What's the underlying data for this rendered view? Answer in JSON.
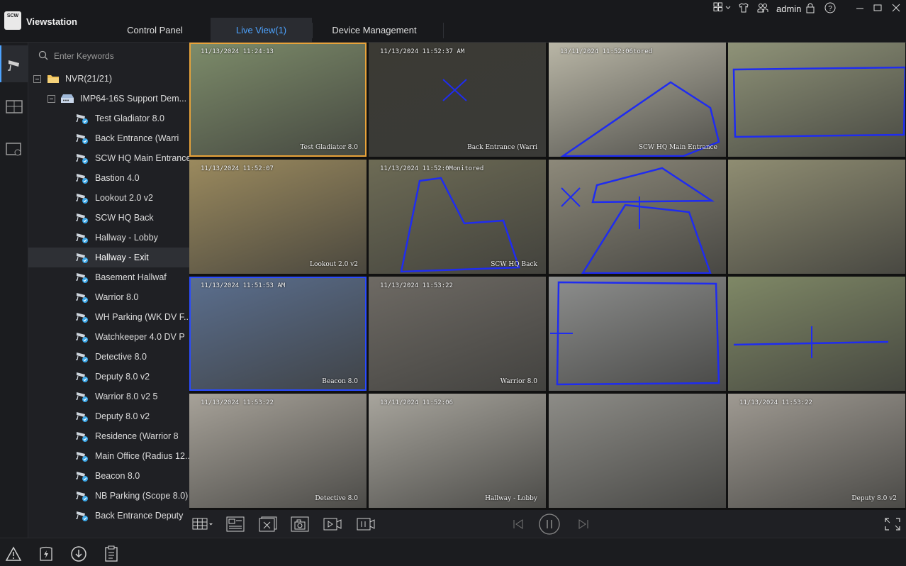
{
  "app": {
    "title": "Viewstation",
    "logo_text": "SCW"
  },
  "tabs": [
    {
      "label": "Control Panel"
    },
    {
      "label": "Live View(1)"
    },
    {
      "label": "Device Management"
    }
  ],
  "user": {
    "name": "admin"
  },
  "icons": {
    "layout": "grid-icon",
    "theme": "shirt-icon",
    "users": "users-icon",
    "lock": "lock-icon",
    "help": "help-icon"
  },
  "search": {
    "placeholder": "Enter Keywords",
    "value": ""
  },
  "tree": {
    "root": "NVR(21/21)",
    "device": "IMP64-16S Support Dem...",
    "cameras": [
      "Test Gladiator 8.0",
      "Back Entrance (Warri",
      "SCW HQ Main Entrance",
      "Bastion 4.0",
      "Lookout 2.0 v2",
      "SCW HQ Back",
      "Hallway - Lobby",
      "Hallway - Exit",
      "Basement Hallwaf",
      "Warrior 8.0",
      "WH Parking (WK DV F...",
      "Watchkeeper 4.0 DV P",
      "Detective 8.0",
      "Deputy 8.0 v2",
      "Warrior 8.0 v2 5",
      "Deputy 8.0 v2",
      "Residence (Warrior 8",
      "Main Office (Radius 12...",
      "Beacon 8.0",
      "NB Parking (Scope 8.0)",
      "Back Entrance Deputy"
    ],
    "selected_index": 7
  },
  "tiles": [
    {
      "ts": "11/13/2024 11:24:13",
      "name": "Test Gladiator 8.0",
      "bg": "#7d8c6a"
    },
    {
      "ts": "11/13/2024 11:52:37 AM",
      "name": "Back Entrance (Warri",
      "bg": "#3b3a34"
    },
    {
      "ts": "13/11/2024 11:52:06tored",
      "name": "SCW HQ Main Entrance",
      "bg": "#b9b6a6"
    },
    {
      "ts": "",
      "name": "",
      "bg": "#8f9378"
    },
    {
      "ts": "11/13/2024 11:52:07",
      "name": "Lookout 2.0 v2",
      "bg": "#9b8a5e"
    },
    {
      "ts": "11/13/2024 11:52:0Monitored",
      "name": "SCW HQ Back",
      "bg": "#6d6b55"
    },
    {
      "ts": "",
      "name": "",
      "bg": "#8d897a"
    },
    {
      "ts": "",
      "name": "",
      "bg": "#8f8d72"
    },
    {
      "ts": "11/13/2024 11:51:53 AM",
      "name": "Beacon 8.0",
      "bg": "#5b6f8f"
    },
    {
      "ts": "11/13/2024 11:53:22",
      "name": "Warrior 8.0",
      "bg": "#6e6a64"
    },
    {
      "ts": "",
      "name": "",
      "bg": "#8e8f8e"
    },
    {
      "ts": "",
      "name": "",
      "bg": "#7f8866"
    },
    {
      "ts": "11/13/2024 11:53:22",
      "name": "Detective 8.0",
      "bg": "#a7a299"
    },
    {
      "ts": "13/11/2024 11:52:06",
      "name": "Hallway - Lobby",
      "bg": "#a8a59d"
    },
    {
      "ts": "",
      "name": "",
      "bg": "#8d8c87"
    },
    {
      "ts": "11/13/2024 11:53:22",
      "name": "Deputy 8.0 v2",
      "bg": "#9f9a92"
    }
  ],
  "toolbar": {
    "left": [
      "layout-grid-icon",
      "window-split-icon",
      "close-all-icon",
      "snapshot-icon",
      "record-icon",
      "video-icon"
    ],
    "center": [
      "previous-icon",
      "pause-icon",
      "next-icon"
    ],
    "right": [
      "fullscreen-icon"
    ]
  },
  "statusbar": [
    "alarm-icon",
    "power-icon",
    "download-icon",
    "log-icon"
  ],
  "colors": {
    "accent": "#4da3ff",
    "select": "#e8a33a",
    "overlay": "#1f2cf0"
  }
}
